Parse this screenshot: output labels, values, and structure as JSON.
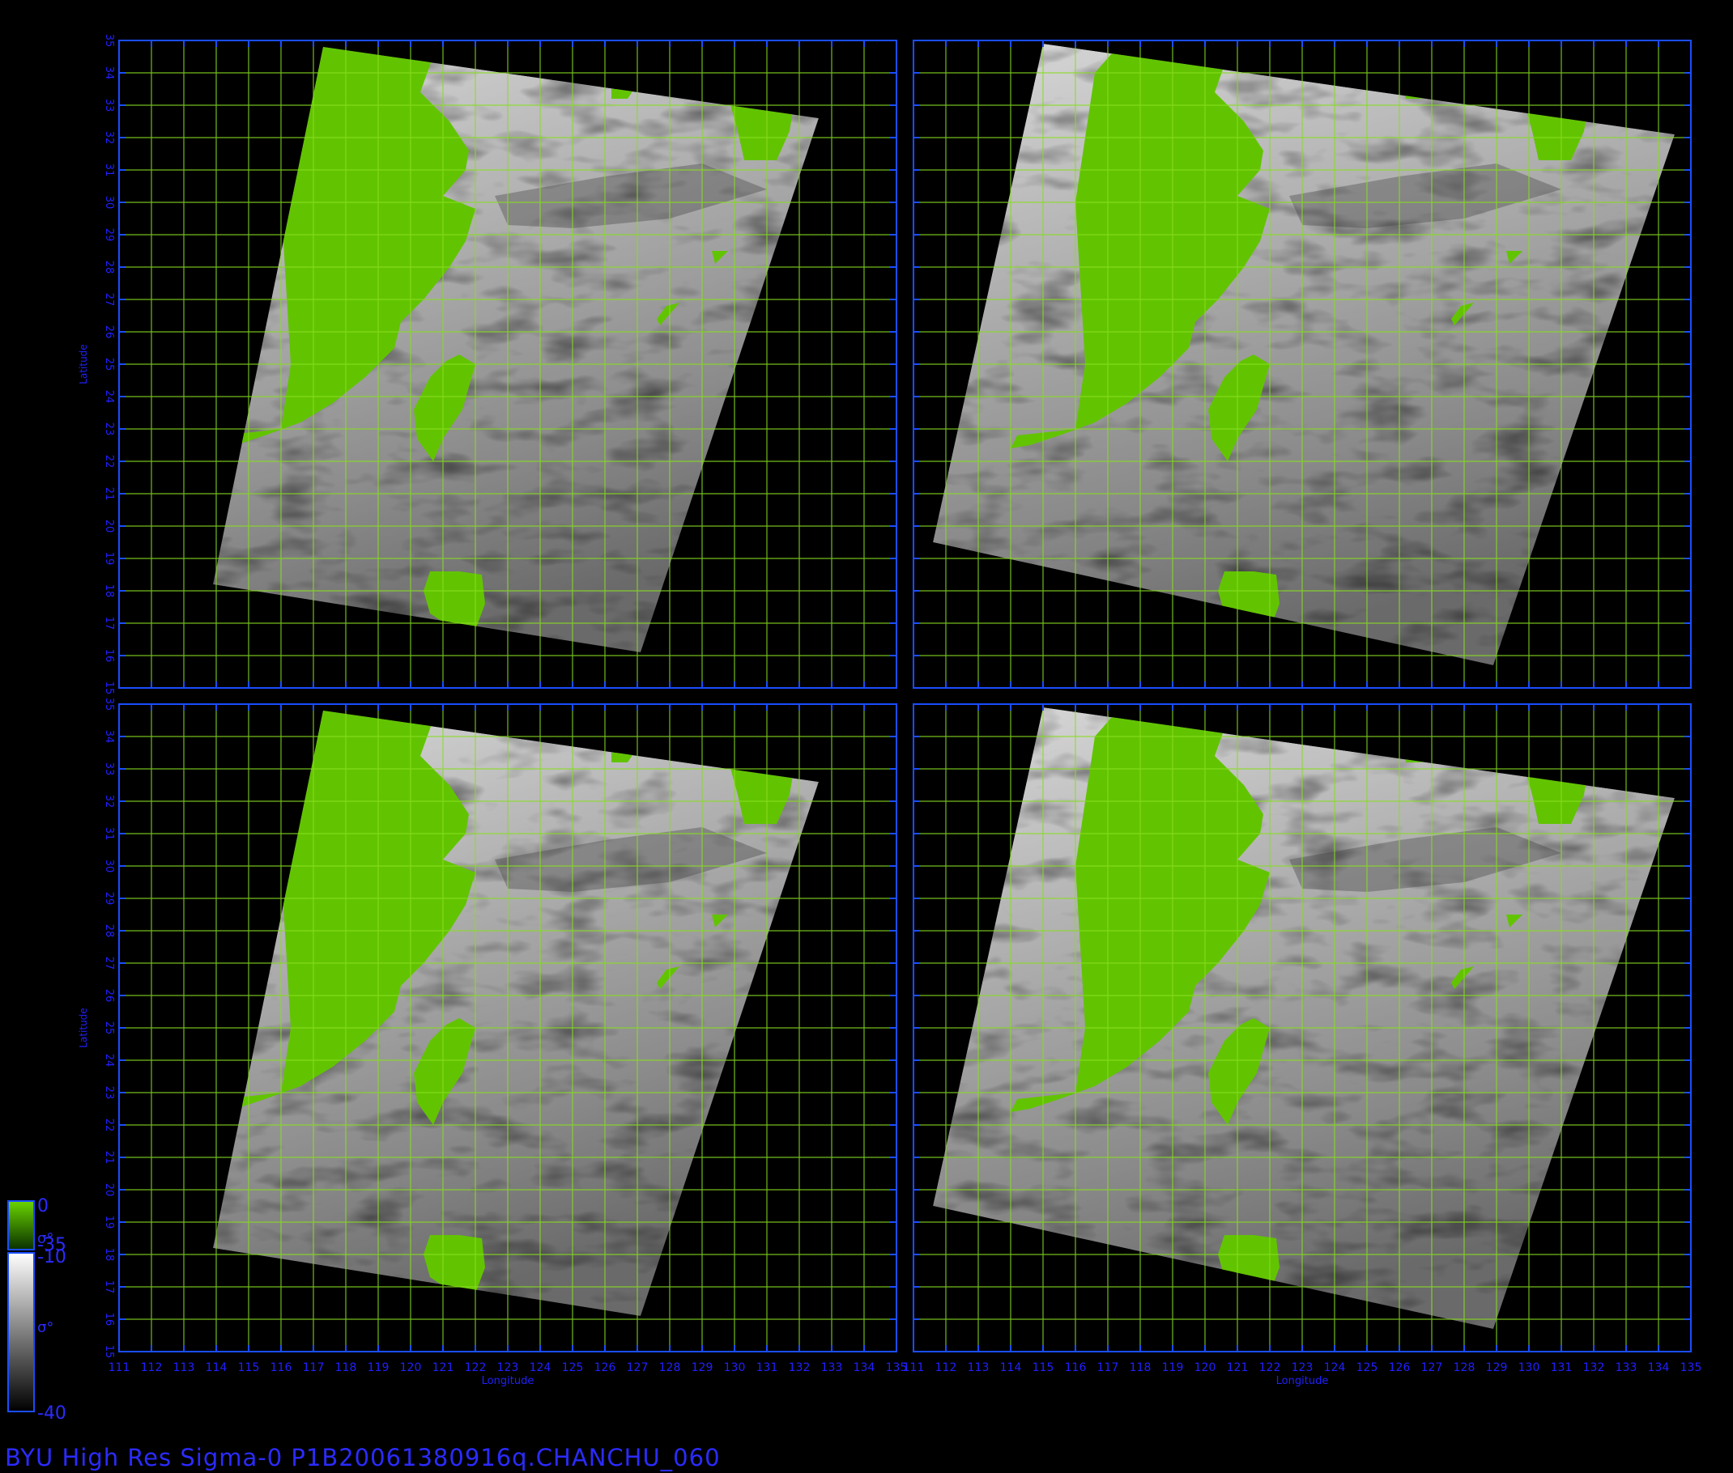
{
  "title": "BYU  High  Res  Sigma-0  P1B20061380916q.CHANCHU_060",
  "axes": {
    "xlabel": "Longitude",
    "ylabel": "Latitude",
    "lon_range": [
      111,
      135
    ],
    "lat_range": [
      15,
      35
    ],
    "lon_ticks": [
      "111",
      "112",
      "113",
      "114",
      "115",
      "116",
      "117",
      "118",
      "119",
      "120",
      "121",
      "122",
      "123",
      "124",
      "125",
      "126",
      "127",
      "128",
      "129",
      "130",
      "131",
      "132",
      "133",
      "134",
      "135"
    ],
    "lat_ticks": [
      "15",
      "16",
      "17",
      "18",
      "19",
      "20",
      "21",
      "22",
      "23",
      "24",
      "25",
      "26",
      "27",
      "28",
      "29",
      "30",
      "31",
      "32",
      "33",
      "34",
      "35"
    ]
  },
  "colorbar": {
    "land": {
      "max": "0",
      "min": "-35",
      "symbol": "σ°",
      "color": "#5fcc00"
    },
    "ocean": {
      "max": "-10",
      "min": "-40",
      "symbol": "σ°"
    }
  },
  "colors": {
    "frame": "#1a4dff",
    "grid": "#88dd22",
    "land": "#62c400",
    "tick_text": "#2020ff"
  },
  "panels": [
    {
      "id": "top-left"
    },
    {
      "id": "top-right"
    },
    {
      "id": "bottom-left"
    },
    {
      "id": "bottom-right"
    }
  ]
}
